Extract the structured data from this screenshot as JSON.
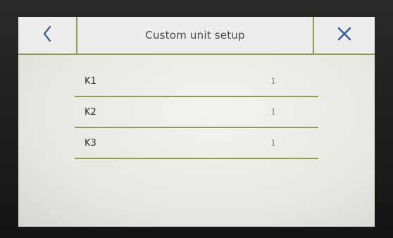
{
  "header": {
    "title": "Custom unit setup",
    "back_icon": "chevron-left-icon",
    "close_icon": "close-icon"
  },
  "colors": {
    "accent": "#8e9a5c",
    "icon": "#3f5f96",
    "screen_bg": "#e9eae5"
  },
  "rows": [
    {
      "label": "K1",
      "value": "1"
    },
    {
      "label": "K2",
      "value": "1"
    },
    {
      "label": "K3",
      "value": "1"
    }
  ]
}
